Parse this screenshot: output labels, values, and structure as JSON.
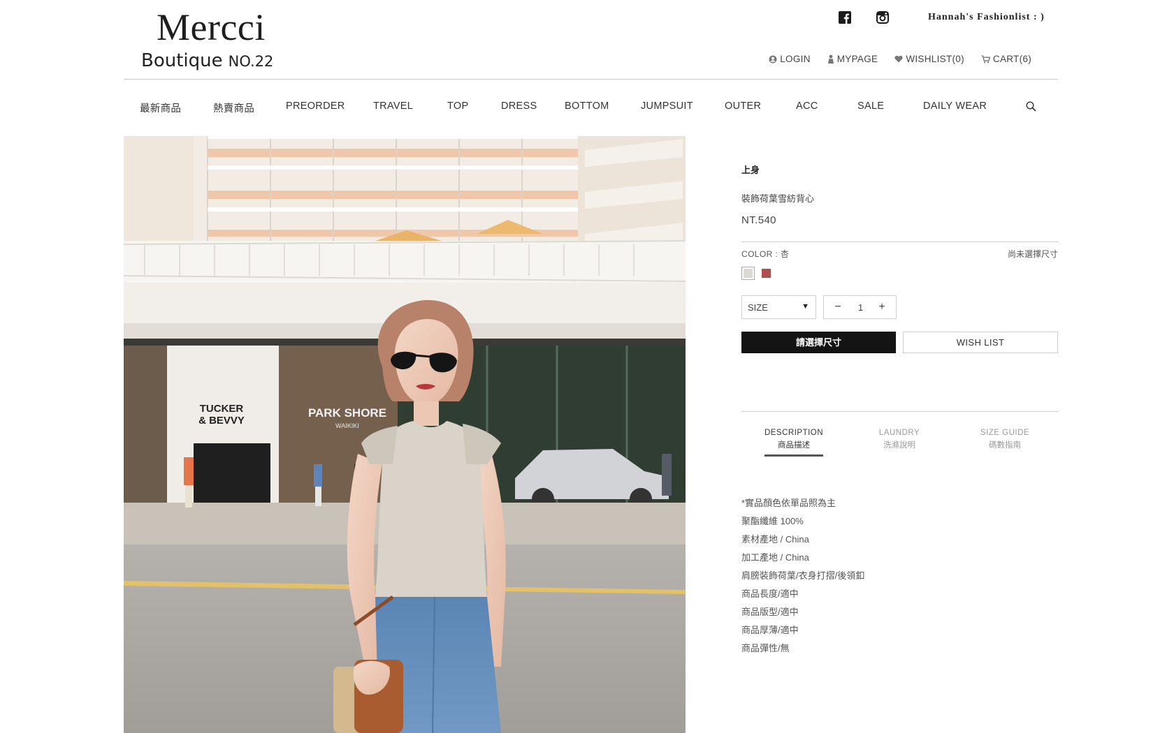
{
  "brand": {
    "name": "Mercci",
    "subtitle": "Boutique",
    "number": "NO.22"
  },
  "header": {
    "social": [
      {
        "icon": "facebook-icon"
      },
      {
        "icon": "instagram-icon"
      }
    ],
    "fashion_link": "Hannah's  Fashionlist  : )",
    "user_nav": [
      {
        "icon": "user-icon",
        "label": "LOGIN"
      },
      {
        "icon": "mypage-icon",
        "label": "MYPAGE"
      },
      {
        "icon": "heart-icon",
        "label": "WISHLIST(0)"
      },
      {
        "icon": "cart-icon",
        "label": "CART(6)"
      }
    ]
  },
  "main_nav": {
    "items": [
      {
        "label": "最新商品"
      },
      {
        "label": "熱賣商品"
      },
      {
        "label": "PREORDER"
      },
      {
        "label": "TRAVEL"
      },
      {
        "label": "TOP"
      },
      {
        "label": "DRESS"
      },
      {
        "label": "BOTTOM"
      },
      {
        "label": "JUMPSUIT"
      },
      {
        "label": "OUTER"
      },
      {
        "label": "ACC"
      },
      {
        "label": "SALE"
      },
      {
        "label": "DAILY WEAR"
      }
    ],
    "search_icon": "search-icon"
  },
  "photo": {
    "sign_left_1": "TUCKER",
    "sign_left_2": "& BEVVY",
    "sign_right_1": "PARK SHORE",
    "sign_right_2": "WAIKIKI"
  },
  "product": {
    "category": "上身",
    "name": "裝飾荷葉雪紡背心",
    "price": "NT.540",
    "color_label": "COLOR : 杏",
    "size_status": "尚未選擇尺寸",
    "swatches": [
      {
        "name": "杏",
        "color": "#ddd9d2"
      },
      {
        "name": "red",
        "color": "#b0504c"
      }
    ],
    "size_select": {
      "value": "SIZE",
      "arrow": "▼"
    },
    "quantity": {
      "minus": "−",
      "value": "1",
      "plus": "+"
    },
    "buy_button": "請選擇尺寸",
    "wish_button": "WISH LIST"
  },
  "tabs": [
    {
      "en": "DESCRIPTION",
      "zh": "商品描述",
      "active": true
    },
    {
      "en": "LAUNDRY",
      "zh": "洗滌說明",
      "active": false
    },
    {
      "en": "SIZE GUIDE",
      "zh": "碼數指南",
      "active": false
    }
  ],
  "description": [
    "*實品顏色依單品照為主",
    "聚酯纖維 100%",
    "素材產地 / China",
    "加工產地 / China",
    "肩膀裝飾荷葉/衣身打摺/後領釦",
    "商品長度/適中",
    "商品版型/適中",
    "商品厚薄/適中",
    "商品彈性/無"
  ],
  "colors": {
    "accent": "#141414",
    "rule": "#cfcfcf",
    "text": "#333333",
    "muted": "#9a9a9a"
  }
}
